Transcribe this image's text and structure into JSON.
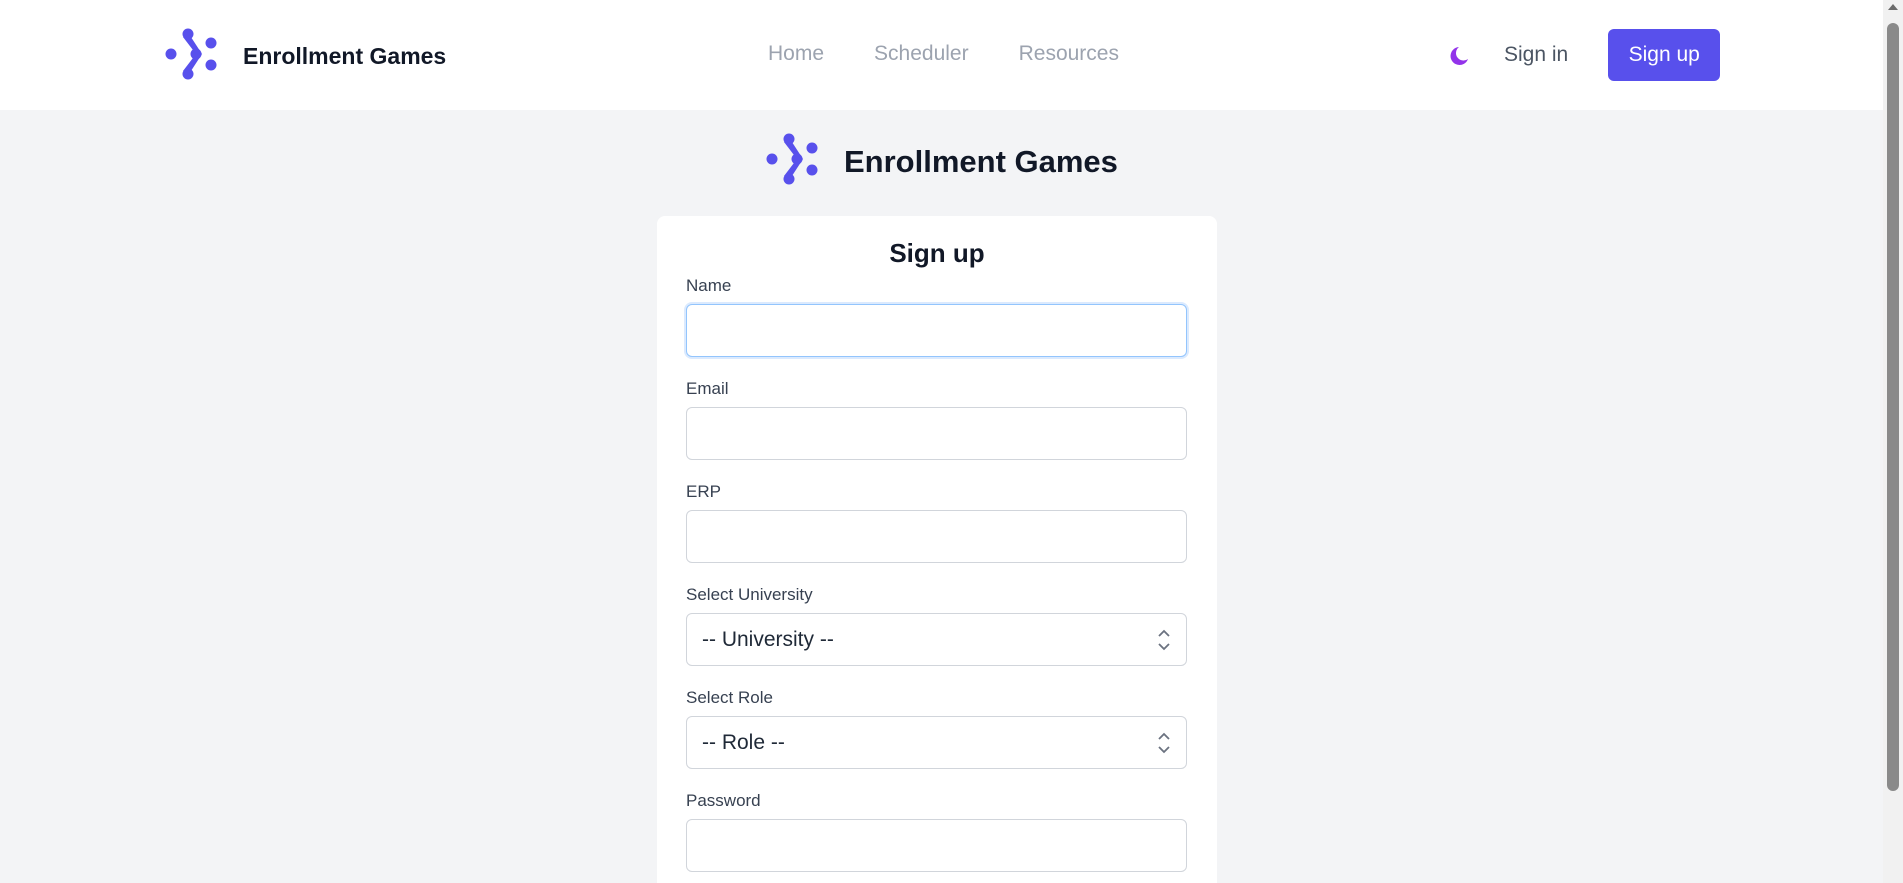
{
  "brand": {
    "name": "Enrollment Games",
    "accent": "#5850ec"
  },
  "nav": {
    "links": [
      "Home",
      "Scheduler",
      "Resources"
    ],
    "theme_icon": "moon-icon",
    "signin_label": "Sign in",
    "signup_label": "Sign up"
  },
  "hero": {
    "name": "Enrollment Games"
  },
  "form": {
    "title": "Sign up",
    "name_label": "Name",
    "name_value": "",
    "email_label": "Email",
    "email_value": "",
    "erp_label": "ERP",
    "erp_value": "",
    "university_label": "Select University",
    "university_selected": "-- University --",
    "role_label": "Select Role",
    "role_selected": "-- Role --",
    "password_label": "Password",
    "password_value": ""
  },
  "colors": {
    "primary": "#5850ec",
    "moon": "#9333ea",
    "background": "#f3f4f6"
  }
}
